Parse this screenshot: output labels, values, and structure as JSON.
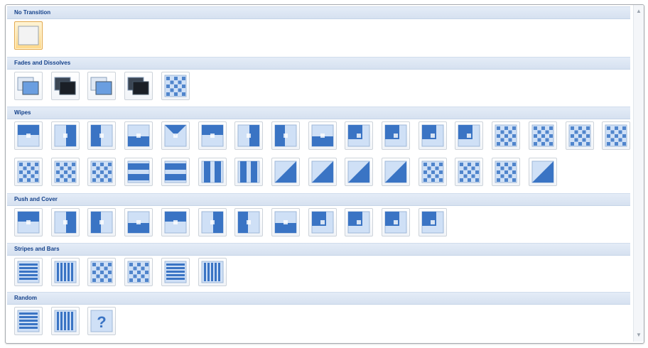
{
  "gallery": {
    "sections": [
      {
        "title": "No Transition",
        "rows": [
          {
            "count": 1,
            "tiles": [
              {
                "icon": "blank-slide-icon",
                "selected": true
              }
            ]
          }
        ]
      },
      {
        "title": "Fades and Dissolves",
        "rows": [
          {
            "count": 5,
            "tiles": [
              {
                "icon": "fade-smoothly-icon"
              },
              {
                "icon": "fade-through-black-icon"
              },
              {
                "icon": "fade-smoothly-alt-icon"
              },
              {
                "icon": "fade-through-black-alt-icon"
              },
              {
                "icon": "dissolve-icon"
              }
            ]
          }
        ]
      },
      {
        "title": "Wipes",
        "rows": [
          {
            "count": 17,
            "tiles": [
              {
                "icon": "wipe-down-icon"
              },
              {
                "icon": "wipe-left-icon"
              },
              {
                "icon": "wipe-right-icon"
              },
              {
                "icon": "wipe-up-icon"
              },
              {
                "icon": "wedge-icon"
              },
              {
                "icon": "uncover-down-icon"
              },
              {
                "icon": "uncover-left-icon"
              },
              {
                "icon": "uncover-right-icon"
              },
              {
                "icon": "uncover-up-icon"
              },
              {
                "icon": "uncover-left-down-icon"
              },
              {
                "icon": "uncover-left-up-icon"
              },
              {
                "icon": "uncover-right-down-icon"
              },
              {
                "icon": "uncover-right-up-icon"
              },
              {
                "icon": "box-in-icon"
              },
              {
                "icon": "box-out-icon"
              },
              {
                "icon": "wheel-clockwise-1-icon"
              },
              {
                "icon": "wheel-clockwise-2-icon"
              }
            ]
          },
          {
            "count": 15,
            "tiles": [
              {
                "icon": "wheel-clockwise-3-icon"
              },
              {
                "icon": "wheel-clockwise-4-icon"
              },
              {
                "icon": "wheel-clockwise-8-icon"
              },
              {
                "icon": "split-horizontal-out-icon"
              },
              {
                "icon": "split-horizontal-in-icon"
              },
              {
                "icon": "split-vertical-out-icon"
              },
              {
                "icon": "split-vertical-in-icon"
              },
              {
                "icon": "strips-left-down-icon"
              },
              {
                "icon": "strips-left-up-icon"
              },
              {
                "icon": "strips-right-down-icon"
              },
              {
                "icon": "strips-right-up-icon"
              },
              {
                "icon": "shape-circle-icon"
              },
              {
                "icon": "shape-diamond-icon"
              },
              {
                "icon": "shape-plus-icon"
              },
              {
                "icon": "newsflash-icon"
              }
            ]
          }
        ]
      },
      {
        "title": "Push and Cover",
        "rows": [
          {
            "count": 12,
            "tiles": [
              {
                "icon": "push-down-icon"
              },
              {
                "icon": "push-left-icon"
              },
              {
                "icon": "push-right-icon"
              },
              {
                "icon": "push-up-icon"
              },
              {
                "icon": "cover-down-icon"
              },
              {
                "icon": "cover-left-icon"
              },
              {
                "icon": "cover-right-icon"
              },
              {
                "icon": "cover-up-icon"
              },
              {
                "icon": "cover-left-down-icon"
              },
              {
                "icon": "cover-left-up-icon"
              },
              {
                "icon": "cover-right-down-icon"
              },
              {
                "icon": "cover-right-up-icon"
              }
            ]
          }
        ]
      },
      {
        "title": "Stripes and Bars",
        "rows": [
          {
            "count": 6,
            "tiles": [
              {
                "icon": "blinds-horizontal-icon"
              },
              {
                "icon": "blinds-vertical-icon"
              },
              {
                "icon": "checkerboard-across-icon"
              },
              {
                "icon": "checkerboard-down-icon"
              },
              {
                "icon": "comb-horizontal-icon"
              },
              {
                "icon": "comb-vertical-icon"
              }
            ]
          }
        ]
      },
      {
        "title": "Random",
        "rows": [
          {
            "count": 3,
            "tiles": [
              {
                "icon": "random-bars-horizontal-icon"
              },
              {
                "icon": "random-bars-vertical-icon"
              },
              {
                "icon": "random-transition-icon",
                "text": "?"
              }
            ]
          }
        ]
      }
    ]
  },
  "colors": {
    "accent": "#3a74c4",
    "accent_dark": "#1f4f93",
    "header_text": "#15428b",
    "selected_border": "#e3a94d"
  }
}
